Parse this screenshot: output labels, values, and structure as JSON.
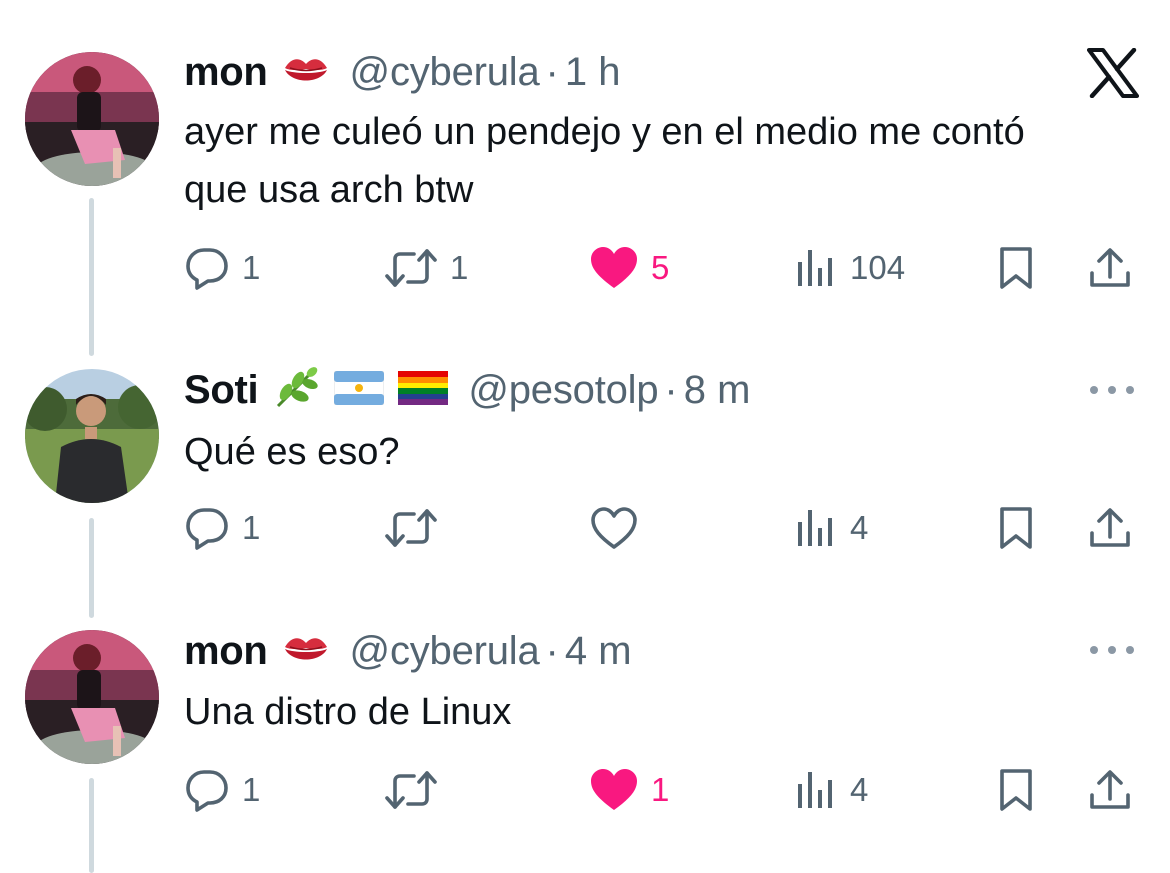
{
  "tweets": [
    {
      "name": "mon",
      "handle": "@cyberula",
      "separator": "·",
      "time": "1 h",
      "text": "ayer me culeó un pendejo y en el medio me contó que usa arch btw",
      "name_emojis": [
        "kiss-mark"
      ],
      "replies": "1",
      "retweets": "1",
      "likes": "5",
      "liked": true,
      "views": "104",
      "top_right": "x-logo-icon"
    },
    {
      "name": "Soti",
      "handle": "@pesotolp",
      "separator": "·",
      "time": "8 m",
      "text": "Qué es eso?",
      "name_emojis": [
        "herb",
        "flag-argentina",
        "rainbow-flag"
      ],
      "replies": "1",
      "retweets": "",
      "likes": "",
      "liked": false,
      "views": "4",
      "top_right": "more-icon"
    },
    {
      "name": "mon",
      "handle": "@cyberula",
      "separator": "·",
      "time": "4 m",
      "text": "Una distro de Linux",
      "name_emojis": [
        "kiss-mark"
      ],
      "replies": "1",
      "retweets": "",
      "likes": "1",
      "liked": true,
      "views": "4",
      "top_right": "more-icon"
    }
  ],
  "colors": {
    "text": "#0f1419",
    "secondary": "#536471",
    "like_pink": "#f91880",
    "thread_line": "#cfd9de"
  }
}
